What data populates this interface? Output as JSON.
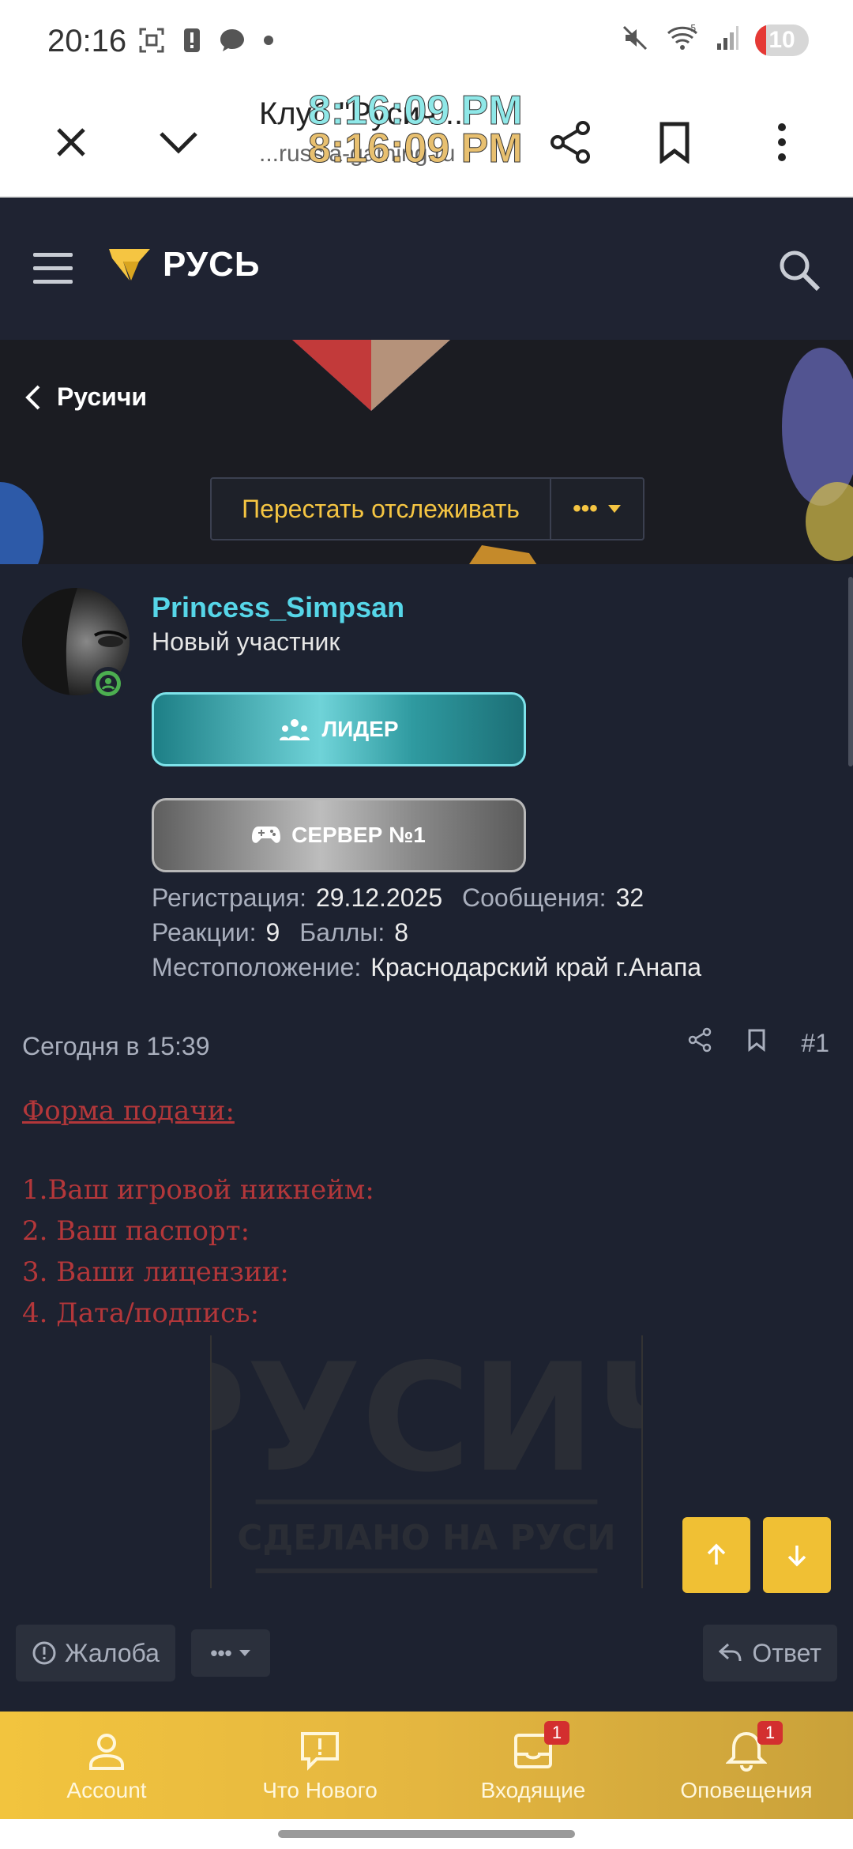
{
  "status_bar": {
    "time": "20:16",
    "battery": "10",
    "icons_left": [
      "screenshot-icon",
      "alert-icon",
      "chat-icon",
      "dot-icon"
    ],
    "icons_right": [
      "mute-icon",
      "wifi-icon",
      "signal-icon",
      "battery-icon"
    ],
    "wifi_label": "5"
  },
  "browser": {
    "title": "Клуб \"Русич...",
    "url": "...russia-gaming.ru",
    "overlay_time_1": "8:16:09 PM",
    "overlay_time_2": "8:16:09 PM"
  },
  "site_header": {
    "logo_text": "РУСЬ"
  },
  "banner": {
    "back_label": "Русичи",
    "follow_label": "Перестать отслеживать",
    "more_label": "•••"
  },
  "post": {
    "username": "Princess_Simpsan",
    "user_title": "Новый участник",
    "role_leader": "ЛИДЕР",
    "role_server": "СЕРВЕР №1",
    "stats": {
      "registration_label": "Регистрация:",
      "registration_value": "29.12.2025",
      "messages_label": "Сообщения:",
      "messages_value": "32",
      "reactions_label": "Реакции:",
      "reactions_value": "9",
      "points_label": "Баллы:",
      "points_value": "8",
      "location_label": "Местоположение:",
      "location_value": "Краснодарский край г.Анапа"
    },
    "date": "Сегодня в 15:39",
    "post_number": "#1",
    "body": {
      "heading": "Форма подачи:",
      "lines": [
        "1.Ваш игровой никнейм:",
        "2. Ваш паспорт:",
        "3. Ваши лицензии:",
        "4. Дата/подпись:"
      ]
    },
    "watermark_title": "РУСИЧ",
    "watermark_sub": "СДЕЛАНО НА РУСИ",
    "report_label": "Жалоба",
    "footer_more_label": "•••",
    "reply_label": "Ответ"
  },
  "bottom_nav": {
    "items": [
      {
        "label": "Account",
        "icon": "user-icon",
        "badge": ""
      },
      {
        "label": "Что Нового",
        "icon": "news-icon",
        "badge": ""
      },
      {
        "label": "Входящие",
        "icon": "inbox-icon",
        "badge": "1"
      },
      {
        "label": "Оповещения",
        "icon": "bell-icon",
        "badge": "1"
      }
    ]
  },
  "colors": {
    "accent": "#f0c034",
    "username": "#56d6e8",
    "post_text": "#b3373a",
    "background": "#1d2230"
  }
}
